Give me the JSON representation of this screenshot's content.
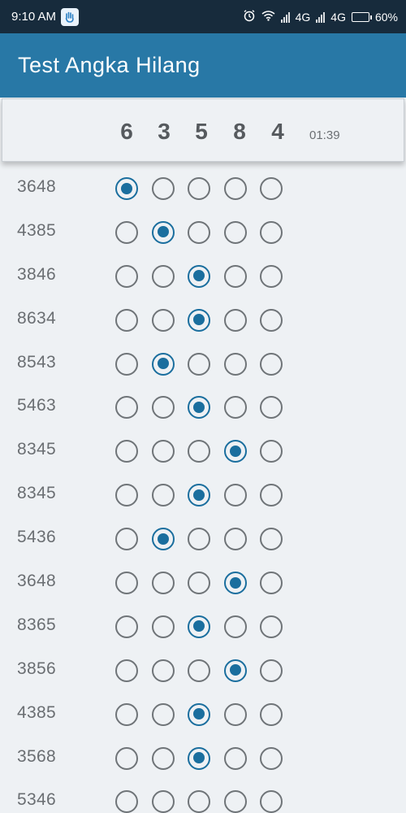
{
  "status_bar": {
    "time": "9:10 AM",
    "network_1": "4G",
    "network_2": "4G",
    "battery": "60%",
    "battery_level": 0.6
  },
  "app_bar": {
    "title": "Test Angka Hilang"
  },
  "target": {
    "digits": [
      "6",
      "3",
      "5",
      "8",
      "4"
    ],
    "timer": "01:39"
  },
  "rows": [
    {
      "number": "3648",
      "selected": 0
    },
    {
      "number": "4385",
      "selected": 1
    },
    {
      "number": "3846",
      "selected": 2
    },
    {
      "number": "8634",
      "selected": 2
    },
    {
      "number": "8543",
      "selected": 1
    },
    {
      "number": "5463",
      "selected": 2
    },
    {
      "number": "8345",
      "selected": 3
    },
    {
      "number": "8345",
      "selected": 2
    },
    {
      "number": "5436",
      "selected": 1
    },
    {
      "number": "3648",
      "selected": 3
    },
    {
      "number": "8365",
      "selected": 2
    },
    {
      "number": "3856",
      "selected": 3
    },
    {
      "number": "4385",
      "selected": 2
    },
    {
      "number": "3568",
      "selected": 2
    },
    {
      "number": "5346",
      "selected": -1
    }
  ],
  "icons": {
    "app_badge": "hand-icon",
    "alarm": "alarm-icon",
    "wifi": "wifi-icon",
    "signal": "signal-icon",
    "battery": "battery-icon"
  },
  "colors": {
    "status_bar": "#172b3c",
    "app_bar": "#2878a6",
    "accent": "#1a6e9e",
    "background": "#eef1f4"
  }
}
